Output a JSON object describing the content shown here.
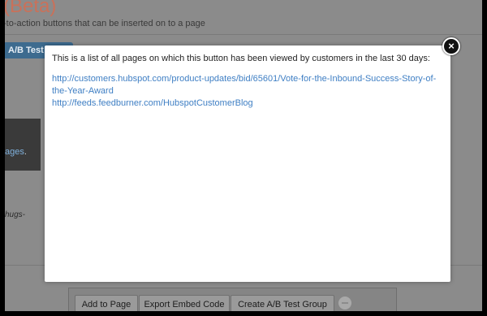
{
  "background": {
    "title": "(Beta)",
    "subtitle": "-to-action buttons that can be inserted on to a page",
    "ab_tab": "A/B Test G",
    "dark_link": "ages",
    "dark_link_suffix": ".",
    "italic_text": "hugs-"
  },
  "toolbar": {
    "add_to_page": "Add to Page",
    "export_embed_code": "Export Embed Code",
    "create_ab_test": "Create A/B Test Group"
  },
  "modal": {
    "description": "This is a list of all pages on which this button has been viewed by customers in the last 30 days:",
    "links": [
      "http://customers.hubspot.com/product-updates/bid/65601/Vote-for-the-Inbound-Success-Story-of-the-Year-Award",
      "http://feeds.feedburner.com/HubspotCustomerBlog"
    ],
    "close_symbol": "×"
  },
  "colors": {
    "overlay": "#8b8b8b",
    "link": "#3f7fc4",
    "title": "#c9715a"
  }
}
